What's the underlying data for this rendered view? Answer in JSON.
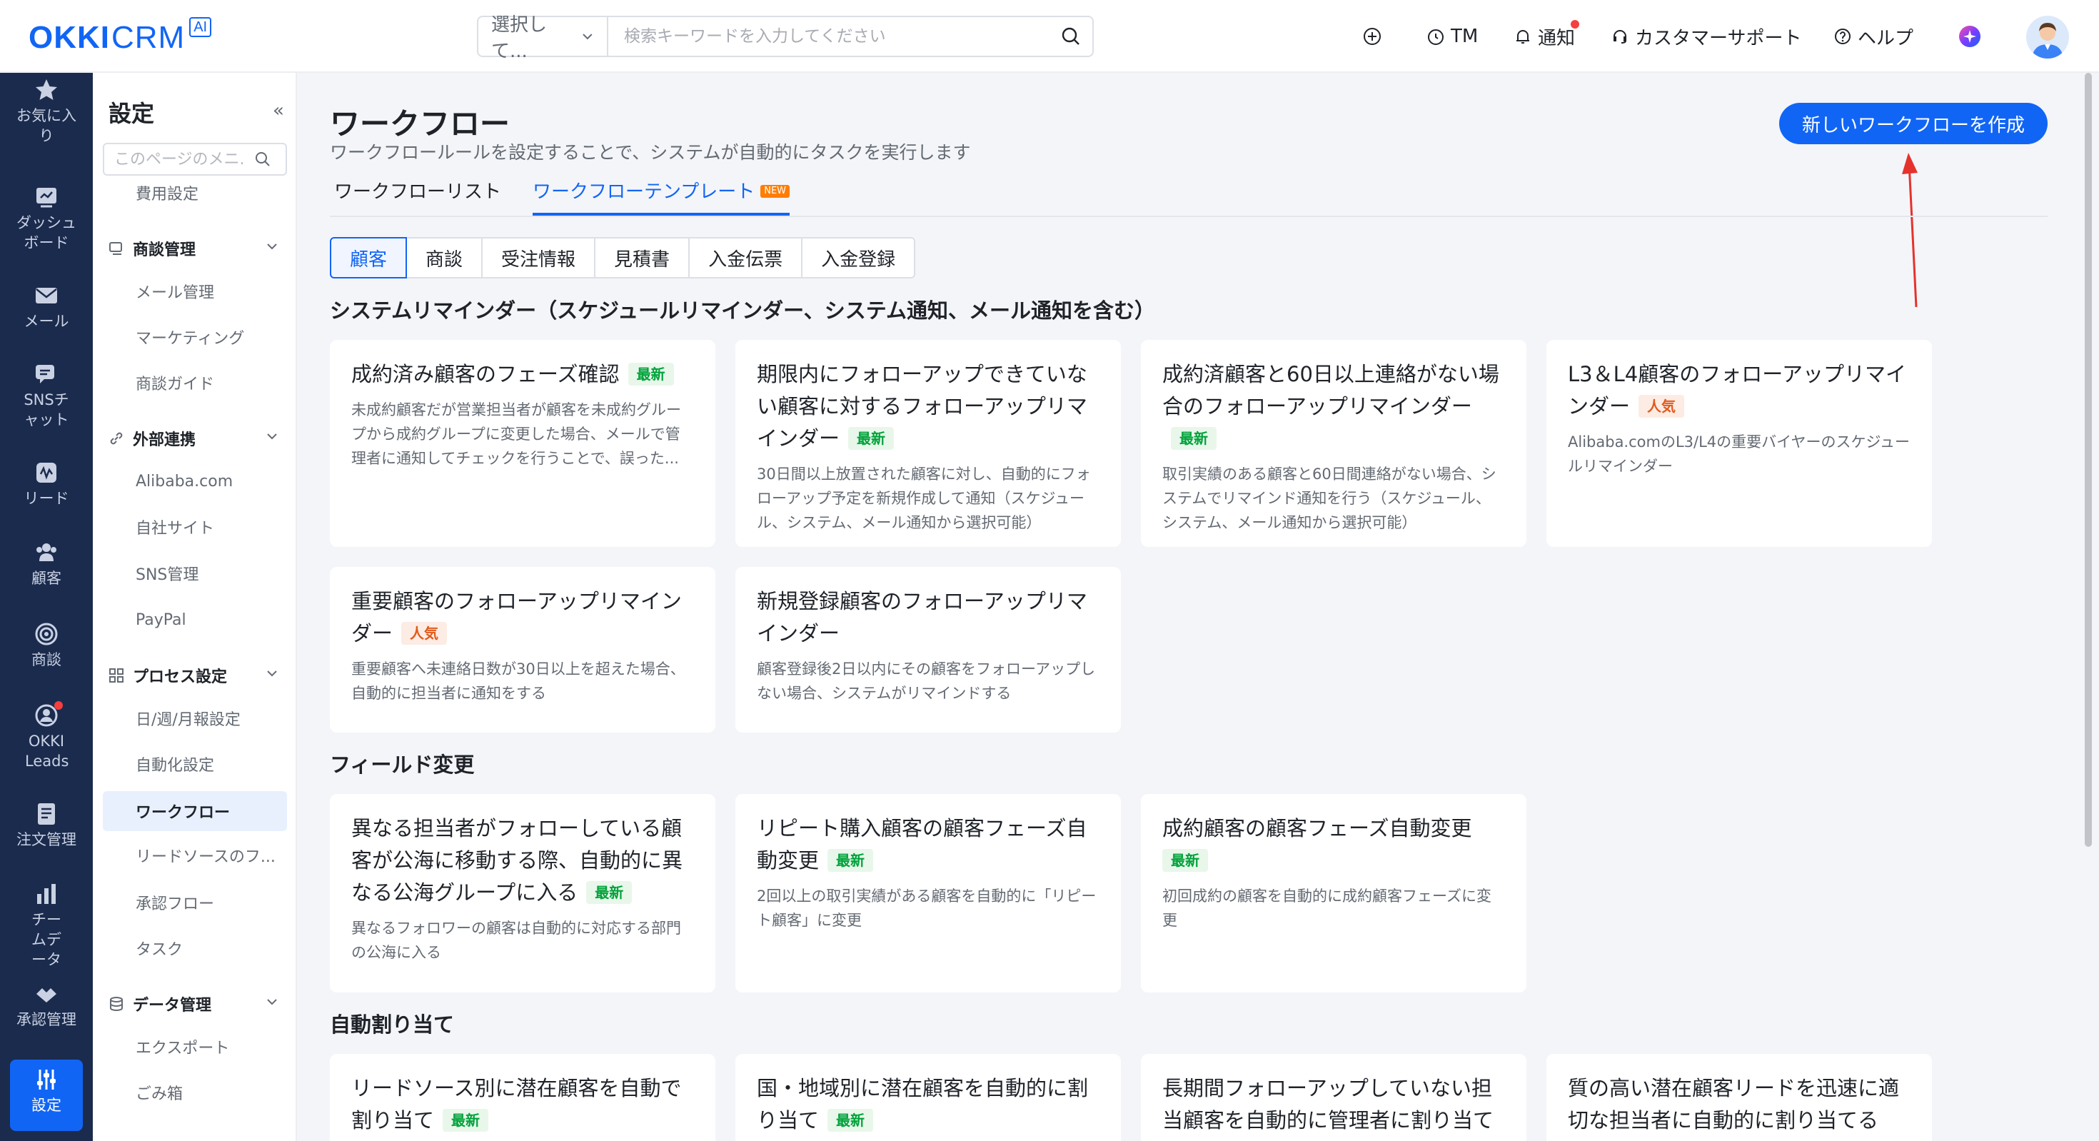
{
  "app": {
    "logo_okki": "OKKI",
    "logo_crm": "CRM",
    "logo_ai": "AI"
  },
  "header": {
    "search_select": "選択して...",
    "search_placeholder": "検索キーワードを入力してください",
    "tm_label": "TM",
    "notify_label": "通知",
    "support_label": "カスタマーサポート",
    "help_label": "ヘルプ"
  },
  "rail": {
    "items": [
      {
        "label": "お気に入り",
        "icon": "star-icon"
      },
      {
        "label": "ダッシュボード",
        "icon": "dashboard-icon"
      },
      {
        "label": "メール",
        "icon": "mail-icon"
      },
      {
        "label": "SNSチャット",
        "icon": "chat-icon"
      },
      {
        "label": "リード",
        "icon": "leads-icon"
      },
      {
        "label": "顧客",
        "icon": "customers-icon"
      },
      {
        "label": "商談",
        "icon": "target-icon"
      },
      {
        "label": "OKKI Leads",
        "icon": "okki-leads-icon"
      },
      {
        "label": "注文管理",
        "icon": "order-icon"
      },
      {
        "label": "チームデータ",
        "icon": "team-data-icon"
      },
      {
        "label": "承認管理",
        "icon": "approval-icon"
      },
      {
        "label": "設定",
        "icon": "settings-icon"
      }
    ]
  },
  "subnav": {
    "title": "設定",
    "search_placeholder": "このページのメニ...",
    "top_item": "費用設定",
    "groups": [
      {
        "label": "商談管理",
        "items": [
          "メール管理",
          "マーケティング",
          "商談ガイド"
        ]
      },
      {
        "label": "外部連携",
        "items": [
          "Alibaba.com",
          "自社サイト",
          "SNS管理",
          "PayPal"
        ]
      },
      {
        "label": "プロセス設定",
        "items": [
          "日/週/月報設定",
          "自動化設定",
          "ワークフロー",
          "リードソースのフ...",
          "承認フロー",
          "タスク"
        ]
      },
      {
        "label": "データ管理",
        "items": [
          "エクスポート",
          "ごみ箱"
        ]
      }
    ]
  },
  "main": {
    "title": "ワークフロー",
    "subtitle": "ワークフロールールを設定することで、システムが自動的にタスクを実行します",
    "create_button": "新しいワークフローを作成",
    "tabs": [
      {
        "label": "ワークフローリスト"
      },
      {
        "label": "ワークフローテンプレート",
        "badge": "NEW"
      }
    ],
    "segments": [
      "顧客",
      "商談",
      "受注情報",
      "見積書",
      "入金伝票",
      "入金登録"
    ],
    "sections": [
      {
        "title": "システムリマインダー（スケジュールリマインダー、システム通知、メール通知を含む）",
        "cards": [
          {
            "title": "成約済み顧客のフェーズ確認",
            "badge": "最新",
            "badge_type": "new",
            "desc": "未成約顧客だが営業担当者が顧客を未成約グループから成約グループに変更した場合、メールで管理者に通知してチェックを行うことで、誤った..."
          },
          {
            "title": "期限内にフォローアップできていない顧客に対するフォローアップリマインダー",
            "badge": "最新",
            "badge_type": "new",
            "desc": "30日間以上放置された顧客に対し、自動的にフォローアップ予定を新規作成して通知（スケジュール、システム、メール通知から選択可能）"
          },
          {
            "title": "成約済顧客と60日以上連絡がない場合のフォローアップリマインダー",
            "badge": "最新",
            "badge_type": "new",
            "desc": "取引実績のある顧客と60日間連絡がない場合、システムでリマインド通知を行う（スケジュール、システム、メール通知から選択可能）"
          },
          {
            "title": "L3＆L4顧客のフォローアップリマインダー",
            "badge": "人気",
            "badge_type": "hot",
            "desc": "Alibaba.comのL3/L4の重要バイヤーのスケジュールリマインダー"
          },
          {
            "title": "重要顧客のフォローアップリマインダー",
            "badge": "人気",
            "badge_type": "hot",
            "desc": "重要顧客へ未連絡日数が30日以上を超えた場合、自動的に担当者に通知をする"
          },
          {
            "title": "新規登録顧客のフォローアップリマインダー",
            "badge": "",
            "badge_type": "",
            "desc": "顧客登録後2日以内にその顧客をフォローアップしない場合、システムがリマインドする"
          }
        ]
      },
      {
        "title": "フィールド変更",
        "cards": [
          {
            "title": "異なる担当者がフォローしている顧客が公海に移動する際、自動的に異なる公海グループに入る",
            "badge": "最新",
            "badge_type": "new",
            "desc": "異なるフォロワーの顧客は自動的に対応する部門の公海に入る"
          },
          {
            "title": "リピート購入顧客の顧客フェーズ自動変更",
            "badge": "最新",
            "badge_type": "new",
            "desc": "2回以上の取引実績がある顧客を自動的に「リピート顧客」に変更"
          },
          {
            "title": "成約顧客の顧客フェーズ自動変更",
            "badge": "最新",
            "badge_type": "new",
            "desc": "初回成約の顧客を自動的に成約顧客フェーズに変更"
          }
        ]
      },
      {
        "title": "自動割り当て",
        "cards": [
          {
            "title": "リードソース別に潜在顧客を自動で割り当て",
            "badge": "最新",
            "badge_type": "new",
            "desc": ""
          },
          {
            "title": "国・地域別に潜在顧客を自動的に割り当て",
            "badge": "最新",
            "badge_type": "new",
            "desc": ""
          },
          {
            "title": "長期間フォローアップしていない担当顧客を自動的に管理者に割り当て",
            "badge": "",
            "badge_type": "",
            "desc": ""
          },
          {
            "title": "質の高い潜在顧客リードを迅速に適切な担当者に自動的に割り当てる",
            "badge": "",
            "badge_type": "",
            "desc": ""
          }
        ]
      }
    ]
  }
}
